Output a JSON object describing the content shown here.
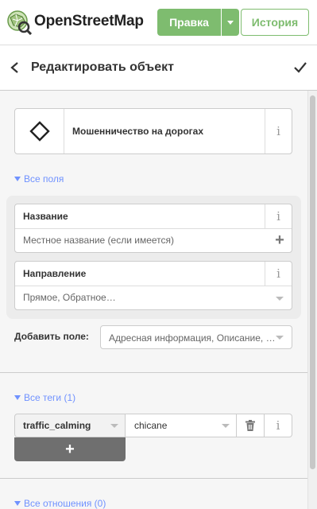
{
  "topbar": {
    "brand": "OpenStreetMap",
    "edit_label": "Правка",
    "history_label": "История",
    "accent": "#7ebc6f"
  },
  "header": {
    "title": "Редактировать объект",
    "back_icon": "chevron-left-icon",
    "done_icon": "checkmark-icon"
  },
  "preset": {
    "name": "Мошенничество на дорогах",
    "icon": "diamond-icon",
    "info": "i"
  },
  "fields_section": {
    "label": "Все поля",
    "fields": [
      {
        "label": "Название",
        "placeholder": "Местное название (если имеется)",
        "info": "i",
        "action": "+"
      },
      {
        "label": "Направление",
        "placeholder": "Прямое, Обратное…",
        "info": "i"
      }
    ],
    "add_field_label": "Добавить поле:",
    "add_field_placeholder": "Адресная информация, Описание, …"
  },
  "tags_section": {
    "label": "Все теги (1)",
    "tags": [
      {
        "key": "traffic_calming",
        "value": "chicane"
      }
    ],
    "info": "i",
    "add_label": "+"
  },
  "relations_section": {
    "label": "Все отношения (0)"
  },
  "colors": {
    "link": "#7092ff",
    "panel_bg": "#f6f6f6"
  }
}
